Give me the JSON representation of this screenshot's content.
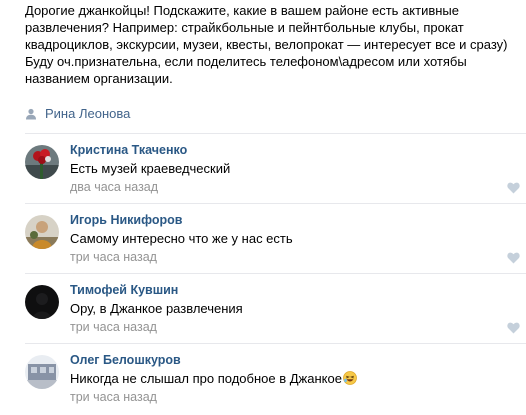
{
  "post": {
    "lines": [
      "Дорогие джанкойцы! Подскажите, какие в вашем районе есть активные",
      "развлечения? Например: страйкбольные и пейнтбольные клубы, прокат",
      "квадроциклов, экскурсии, музеи, квесты, велопрокат — интересует все и сразу)",
      "Буду оч.признательна, если поделитесь телефоном\\адресом или хотябы",
      "названием организации."
    ],
    "author": "Рина Леонова",
    "author_icon": "person-icon"
  },
  "comments": [
    {
      "name": "Кристина Ткаченко",
      "text": "Есть музей краеведческий",
      "time": "два часа назад"
    },
    {
      "name": "Игорь Никифоров",
      "text": "Самому интересно что же у нас есть",
      "time": "три часа назад"
    },
    {
      "name": "Тимофей Кувшин",
      "text": "Ору, в Джанкое развлечения",
      "time": "три часа назад"
    },
    {
      "name": "Олег Белошкуров",
      "text": "Никогда не слышал про подобное в Джанкое",
      "time": "три часа назад"
    }
  ],
  "colors": {
    "link": "#2a5885",
    "author": "#42648b",
    "meta": "#939393",
    "divider": "#e7e8ec"
  }
}
